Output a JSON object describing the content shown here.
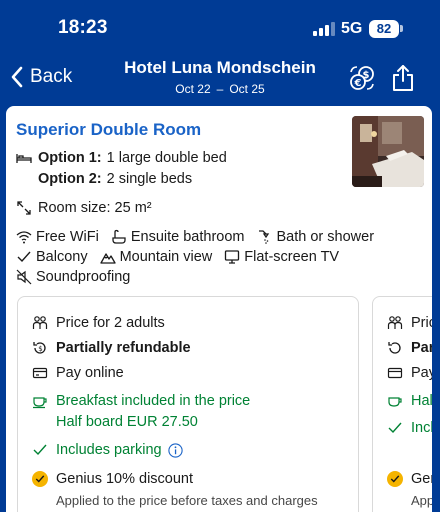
{
  "status_bar": {
    "time": "18:23",
    "network": "5G",
    "battery": "82",
    "icons": [
      "signal-icon",
      "battery-icon"
    ]
  },
  "nav": {
    "back_label": "Back",
    "title": "Hotel Luna Mondschein",
    "date_from": "Oct 22",
    "date_sep": "–",
    "date_to": "Oct 25",
    "icons": [
      "chevron-left-icon",
      "currency-exchange-icon",
      "share-icon"
    ]
  },
  "room": {
    "title": "Superior Double Room",
    "option1_label": "Option 1:",
    "option1_value": "1 large double bed",
    "option2_label": "Option 2:",
    "option2_value": "2 single beds",
    "size": "Room size: 25 m²",
    "amenities": [
      {
        "label": "Free WiFi",
        "icon": "wifi-icon"
      },
      {
        "label": "Ensuite bathroom",
        "icon": "bathroom-icon"
      },
      {
        "label": "Bath or shower",
        "icon": "shower-icon"
      },
      {
        "label": "Balcony",
        "icon": "check-icon"
      },
      {
        "label": "Mountain view",
        "icon": "mountain-icon"
      },
      {
        "label": "Flat-screen TV",
        "icon": "tv-icon"
      },
      {
        "label": "Soundproofing",
        "icon": "soundproof-icon"
      }
    ]
  },
  "rate_option": {
    "price_for": "Price for 2 adults",
    "refund": "Partially refundable",
    "pay": "Pay online",
    "breakfast": "Breakfast included in the price",
    "half_board": "Half board EUR 27.50",
    "parking": "Includes parking",
    "genius": "Genius 10% discount",
    "genius_note": "Applied to the price before taxes and charges"
  },
  "peek_option": {
    "price_for": "Pric",
    "refund": "Par",
    "pay": "Pay",
    "breakfast": "Half",
    "parking": "Incl",
    "genius": "Ger",
    "genius_note": "App"
  },
  "colors": {
    "header_bg": "#003b95",
    "title_blue": "#1a63c7",
    "green": "#008234",
    "genius_yellow": "#f5b400"
  }
}
